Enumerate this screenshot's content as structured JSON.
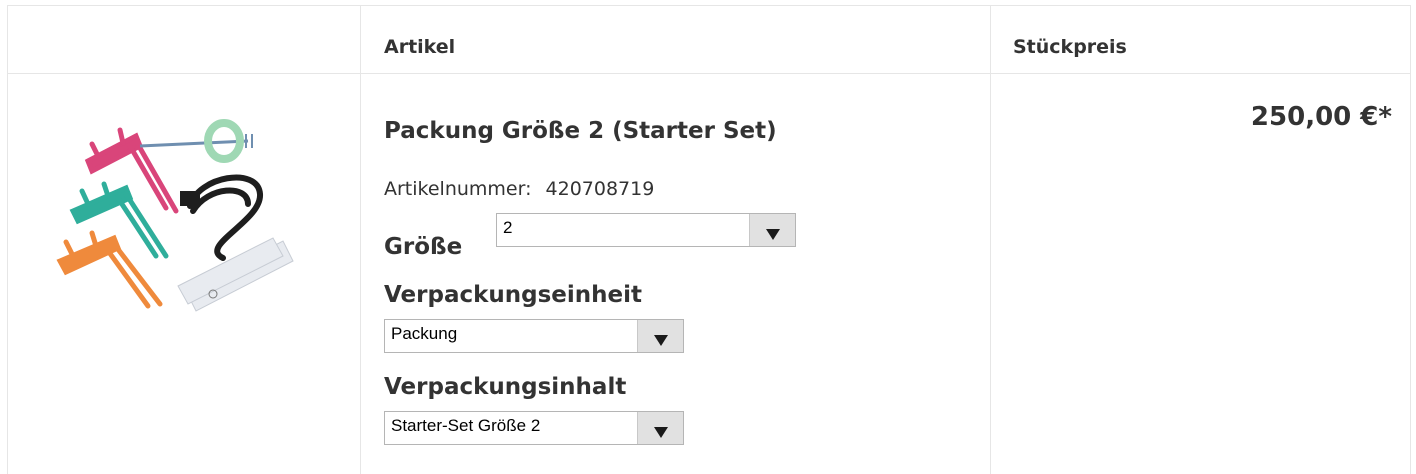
{
  "table": {
    "headers": {
      "article": "Artikel",
      "unit_price": "Stückpreis"
    }
  },
  "product": {
    "image_name": "product-image",
    "title": "Packung Größe 2 (Starter Set)",
    "article_number_label": "Artikelnummer:",
    "article_number": "420708719",
    "price": "250,00 €*"
  },
  "options": {
    "size": {
      "label": "Größe",
      "selected": "2"
    },
    "packaging_unit": {
      "label": "Verpackungseinheit",
      "selected": "Packung"
    },
    "packaging_content": {
      "label": "Verpackungsinhalt",
      "selected": "Starter-Set Größe 2"
    }
  },
  "colors": {
    "text": "#333333",
    "border": "#e6e6e6",
    "select_button": "#e1e1e1",
    "holder_pink": "#d9457a",
    "holder_teal": "#2fae9b",
    "holder_orange": "#ef8a3c",
    "ring_green": "#9fd8b4"
  }
}
